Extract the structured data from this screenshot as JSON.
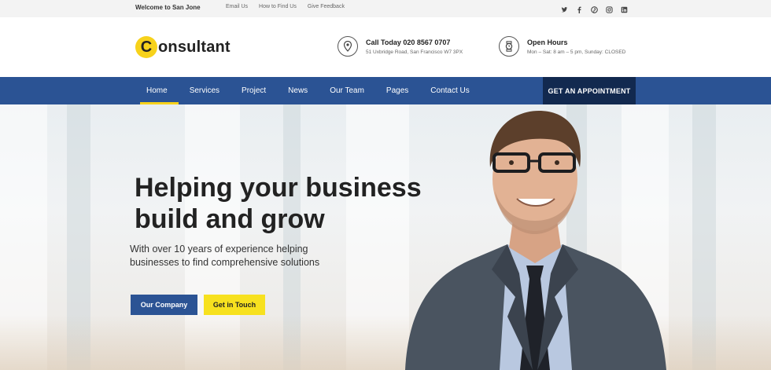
{
  "topbar": {
    "welcome": "Welcome to San Jone",
    "links": [
      "Email Us",
      "How to Find Us",
      "Give Feedback"
    ],
    "social_icons": [
      "twitter-icon",
      "facebook-icon",
      "pinterest-icon",
      "instagram-icon",
      "linkedin-icon"
    ]
  },
  "header": {
    "logo_letter": "C",
    "logo_text": "onsultant",
    "phone": {
      "title": "Call Today 020 8567 0707",
      "subtitle": "51 Uxbridge Road, San Francisco W7 3PX"
    },
    "hours": {
      "title": "Open Hours",
      "subtitle": "Mon – Sat: 8 am – 5 pm, Sunday: CLOSED"
    }
  },
  "nav": {
    "items": [
      "Home",
      "Services",
      "Project",
      "News",
      "Our Team",
      "Pages",
      "Contact Us"
    ],
    "active": "Home",
    "cta": "GET AN APPOINTMENT"
  },
  "hero": {
    "title_line1": "Helping your business",
    "title_line2": "build and grow",
    "subtitle_line1": "With over 10 years of experience helping",
    "subtitle_line2": "businesses to find comprehensive solutions",
    "button_primary": "Our Company",
    "button_secondary": "Get in Touch"
  },
  "colors": {
    "brand_blue": "#2b5394",
    "brand_dark": "#12294f",
    "accent_yellow": "#f7d21b"
  }
}
